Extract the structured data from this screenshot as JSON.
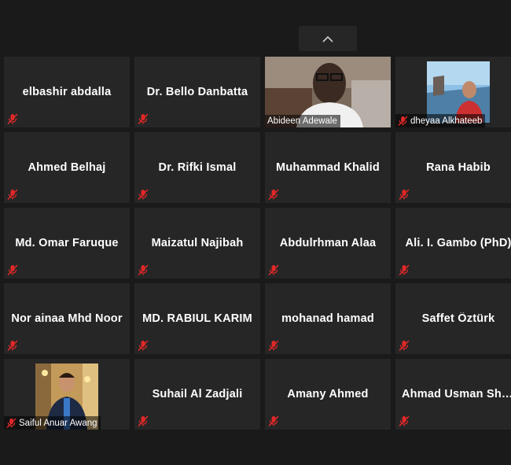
{
  "participants": [
    {
      "name": "elbashir abdalla",
      "muted": true,
      "video": false
    },
    {
      "name": "Dr. Bello  Danbatta",
      "muted": true,
      "video": false
    },
    {
      "name": "Abideen Adewale",
      "muted": false,
      "video": true
    },
    {
      "name": "dheyaa Alkhateeb",
      "muted": true,
      "video": true
    },
    {
      "name": "Ahmed Belhaj",
      "muted": true,
      "video": false
    },
    {
      "name": "Dr. Rifki Ismal",
      "muted": true,
      "video": false
    },
    {
      "name": "Muhammad  Khalid",
      "muted": true,
      "video": false
    },
    {
      "name": "Rana Habib",
      "muted": true,
      "video": false
    },
    {
      "name": "Md. Omar  Faruque",
      "muted": true,
      "video": false
    },
    {
      "name": "Maizatul  Najibah",
      "muted": true,
      "video": false
    },
    {
      "name": "Abdulrhman  Alaa",
      "muted": true,
      "video": false
    },
    {
      "name": "Ali. I. Gambo (PhD)",
      "muted": true,
      "video": false
    },
    {
      "name": "Nor ainaa  Mhd Noor",
      "muted": true,
      "video": false
    },
    {
      "name": "MD. RABIUL KARIM",
      "muted": true,
      "video": false
    },
    {
      "name": "mohanad hamad",
      "muted": true,
      "video": false
    },
    {
      "name": "Saffet Öztürk",
      "muted": true,
      "video": false
    },
    {
      "name": "Saiful Anuar Awang",
      "muted": true,
      "video": true
    },
    {
      "name": "Suhail Al Zadjali",
      "muted": true,
      "video": false
    },
    {
      "name": "Amany Ahmed",
      "muted": true,
      "video": false
    },
    {
      "name": "Ahmad Usman Shehu",
      "muted": true,
      "video": false
    }
  ],
  "colors": {
    "background": "#1a1a1a",
    "tile": "#262626",
    "mute_icon": "#e02828"
  },
  "icons": {
    "collapse": "chevron-up-icon",
    "muted": "mic-muted-icon"
  }
}
